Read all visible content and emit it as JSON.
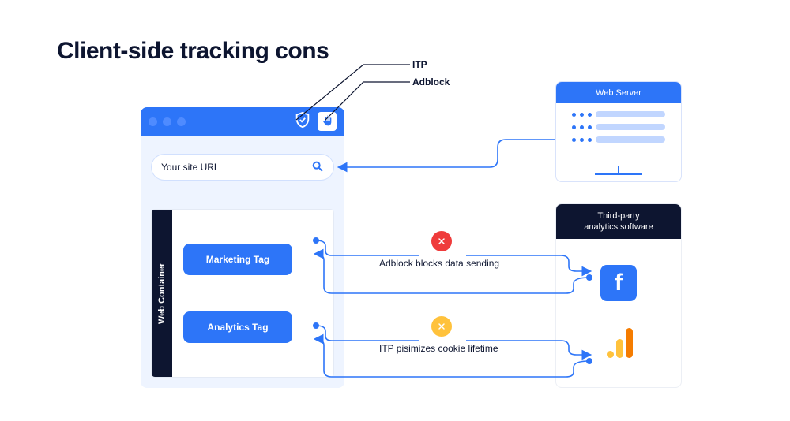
{
  "title": "Client-side tracking cons",
  "annotations": {
    "itp": "ITP",
    "adblock": "Adblock"
  },
  "browser": {
    "url_placeholder": "Your site URL",
    "container_label": "Web Container",
    "tags": {
      "marketing": "Marketing Tag",
      "analytics": "Analytics Tag"
    }
  },
  "server": {
    "title": "Web Server"
  },
  "third_party": {
    "title": "Third-party\nanalytics software"
  },
  "messages": {
    "adblock": "Adblock blocks data sending",
    "itp": "ITP pisimizes cookie lifetime"
  },
  "icons": {
    "shield": "shield-check-icon",
    "hand": "hand-stop-icon",
    "search": "search-icon",
    "close": "close-icon",
    "facebook": "facebook-icon",
    "ga": "google-analytics-icon"
  },
  "colors": {
    "primary": "#2d75f8",
    "dark": "#0d1530",
    "warn": "#ffc23c",
    "error": "#ef3b3b",
    "orange": "#f57c00"
  }
}
